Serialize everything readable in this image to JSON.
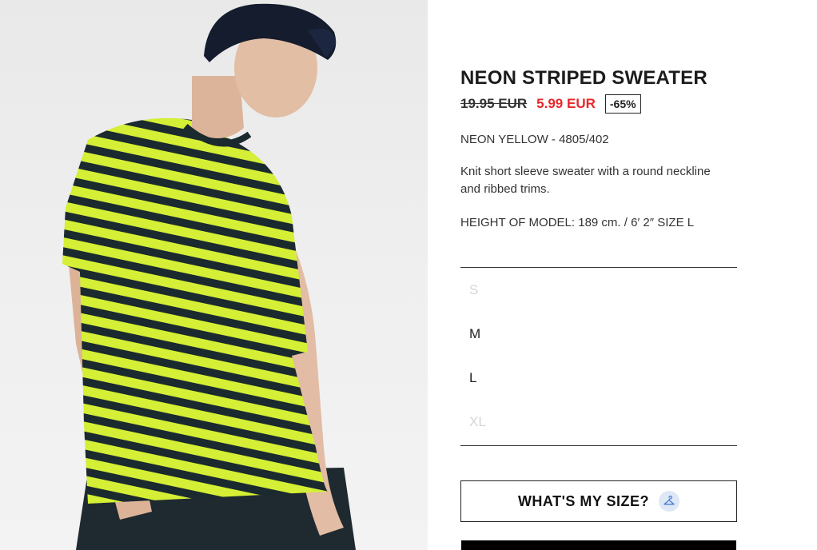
{
  "product": {
    "title": "NEON STRIPED SWEATER",
    "old_price": "19.95 EUR",
    "new_price": "5.99 EUR",
    "discount": "-65%",
    "color_ref": "NEON YELLOW - 4805/402",
    "description": "Knit short sleeve sweater with a round neckline and ribbed trims.",
    "model_info": "HEIGHT OF MODEL: 189 cm. / 6′ 2″ SIZE L"
  },
  "sizes": [
    {
      "label": "S",
      "available": false
    },
    {
      "label": "M",
      "available": true
    },
    {
      "label": "L",
      "available": true
    },
    {
      "label": "XL",
      "available": false
    }
  ],
  "size_button": {
    "label": "WHAT'S MY SIZE?",
    "icon": "hanger-icon"
  },
  "colors": {
    "price_sale": "#e8272c",
    "stripe_yellow": "#d4ef35",
    "stripe_navy": "#1b2a2e",
    "icon_bg": "#dde7f6"
  }
}
